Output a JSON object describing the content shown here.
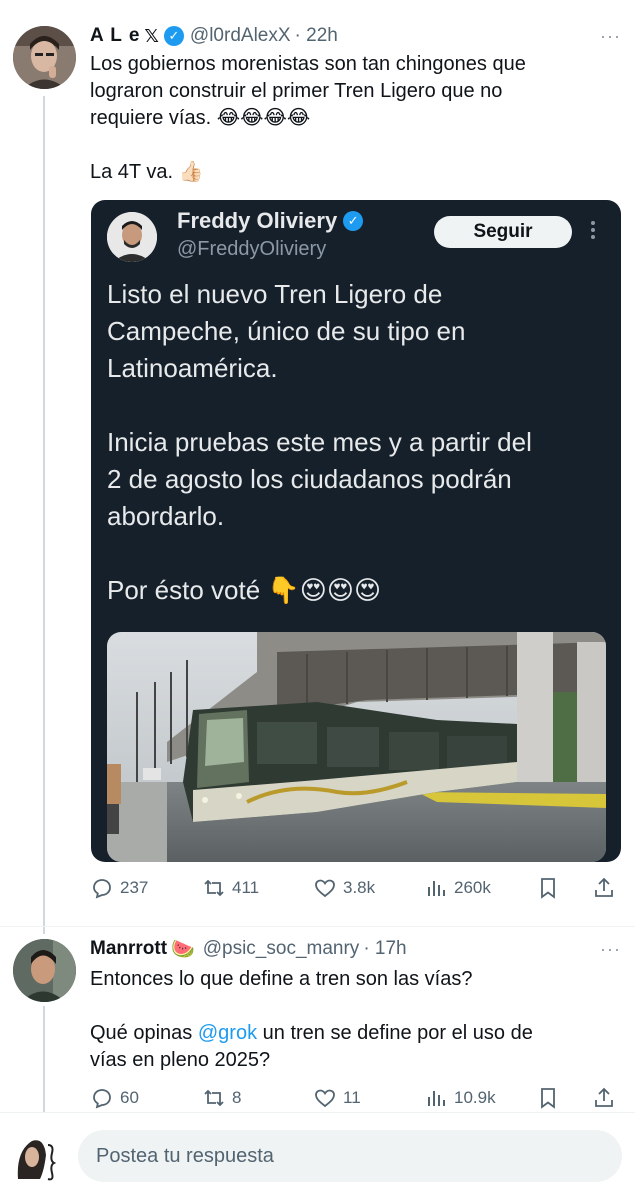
{
  "tweet1": {
    "name": "A L e",
    "handle": "@l0rdAlexX",
    "time": "· 22h",
    "more": "···",
    "text": "Los gobiernos morenistas son tan chingones que\nlograron construir el primer Tren Ligero que no\nrequiere vías. 😂😂😂😂\n\nLa 4T va. 👍🏻",
    "quote": {
      "name": "Freddy Oliviery",
      "handle": "@FreddyOliviery",
      "follow_label": "Seguir",
      "more": "⋮",
      "text": "Listo el nuevo Tren Ligero de\nCampeche, único de su tipo en\nLatinoamérica.\n\nInicia pruebas este mes y a partir del\n2 de agosto los ciudadanos podrán\nabordarlo.\n\nPor ésto voté 👇😍😍😍"
    },
    "stats": {
      "replies": "237",
      "retweets": "411",
      "likes": "3.8k",
      "views": "260k"
    }
  },
  "tweet2": {
    "name": "Manrrott",
    "name_emoji": "🍉",
    "handle": "@psic_soc_manry",
    "time": "· 17h",
    "more": "···",
    "text_line1": "Entonces lo que define a tren son las vías?",
    "text_pre": "Qué opinas ",
    "mention": "@grok",
    "text_post": " un tren se define por el uso de\nvías en pleno 2025?",
    "stats": {
      "replies": "60",
      "retweets": "8",
      "likes": "11",
      "views": "10.9k"
    }
  },
  "reply": {
    "placeholder": "Postea tu respuesta"
  },
  "colors": {
    "accent": "#1d9bf0",
    "quote_bg": "#15202b",
    "muted": "#536471"
  }
}
